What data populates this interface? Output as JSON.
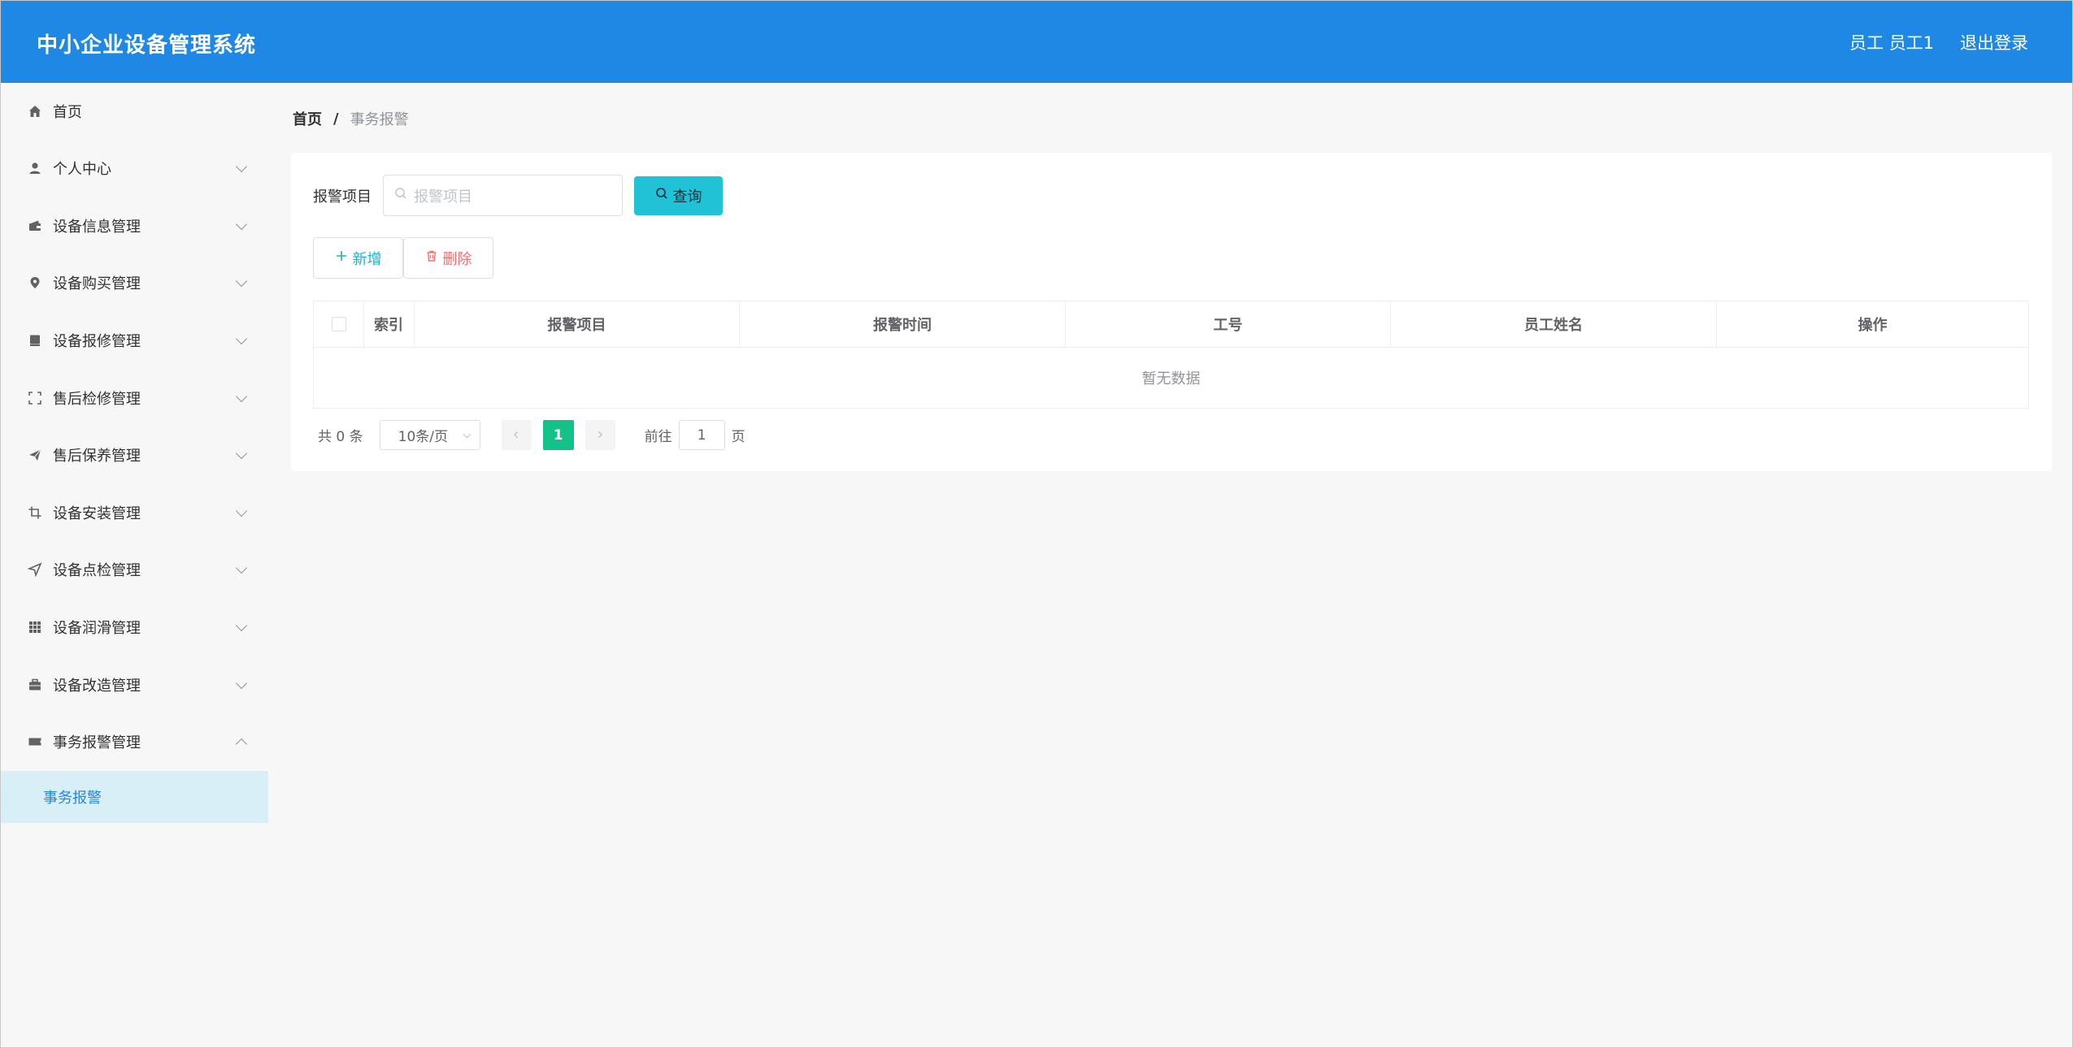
{
  "header": {
    "app_title": "中小企业设备管理系统",
    "user_label": "员工 员工1",
    "logout_label": "退出登录"
  },
  "sidebar": {
    "items": [
      {
        "label": "首页",
        "icon": "home-icon"
      },
      {
        "label": "个人中心",
        "icon": "user-icon"
      },
      {
        "label": "设备信息管理",
        "icon": "wallet-icon"
      },
      {
        "label": "设备购买管理",
        "icon": "location-icon"
      },
      {
        "label": "设备报修管理",
        "icon": "notebook-icon"
      },
      {
        "label": "售后检修管理",
        "icon": "full-screen-icon"
      },
      {
        "label": "售后保养管理",
        "icon": "send-icon"
      },
      {
        "label": "设备安装管理",
        "icon": "crop-icon"
      },
      {
        "label": "设备点检管理",
        "icon": "position-icon"
      },
      {
        "label": "设备润滑管理",
        "icon": "grid-icon"
      },
      {
        "label": "设备改造管理",
        "icon": "suitcase-icon"
      },
      {
        "label": "事务报警管理",
        "icon": "ticket-icon"
      }
    ],
    "active_sub_item": "事务报警"
  },
  "breadcrumb": {
    "home": "首页",
    "separator": "/",
    "current": "事务报警"
  },
  "search": {
    "label": "报警项目",
    "placeholder": "报警项目",
    "button_label": "查询"
  },
  "actions": {
    "add_label": "新增",
    "delete_label": "删除"
  },
  "table": {
    "columns": [
      "索引",
      "报警项目",
      "报警时间",
      "工号",
      "员工姓名",
      "操作"
    ],
    "empty_text": "暂无数据"
  },
  "pagination": {
    "total_text": "共 0 条",
    "page_size": "10条/页",
    "current_page": "1",
    "goto_prefix": "前往",
    "goto_value": "1",
    "goto_suffix": "页"
  },
  "colors": {
    "header_bg": "#1f88e5",
    "search_button": "#21c1d6",
    "active_page": "#14c188",
    "active_menu_bg": "#d8eff7"
  }
}
